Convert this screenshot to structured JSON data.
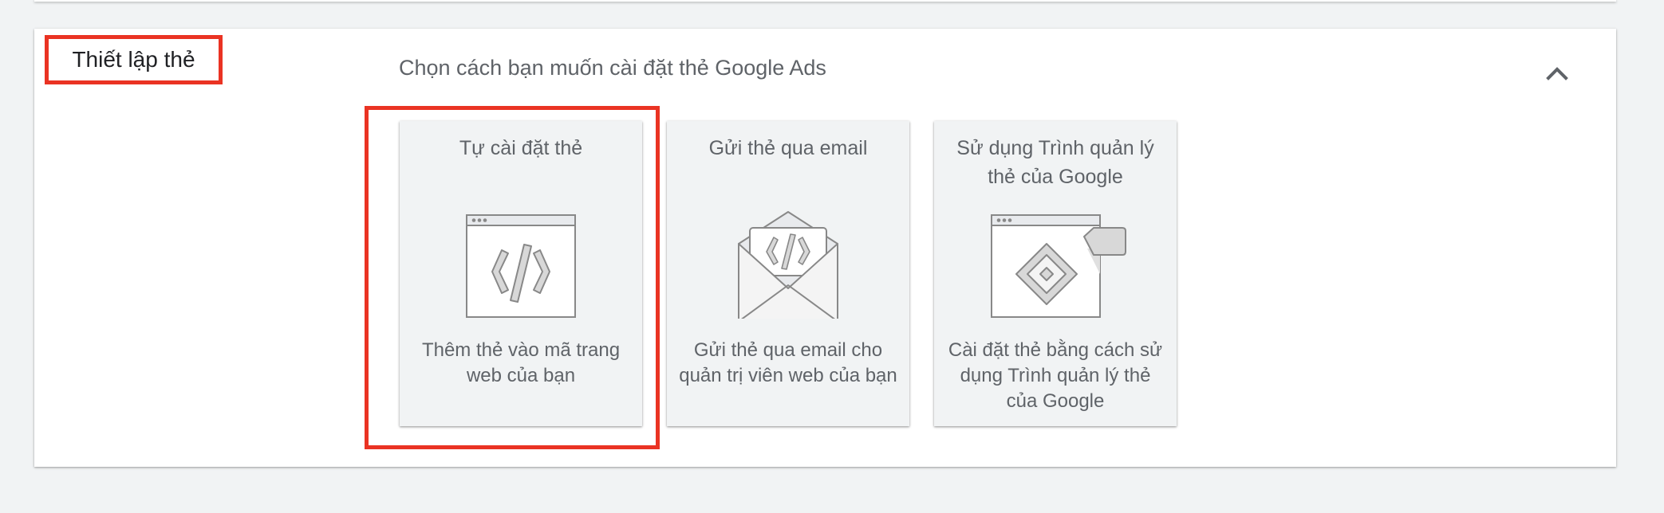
{
  "section": {
    "title": "Thiết lập thẻ",
    "prompt": "Chọn cách bạn muốn cài đặt thẻ Google Ads"
  },
  "options": [
    {
      "title": "Tự cài đặt thẻ",
      "description": "Thêm thẻ vào mã trang web của bạn",
      "icon": "browser-code-icon",
      "highlighted": true
    },
    {
      "title": "Gửi thẻ qua email",
      "description": "Gửi thẻ qua email cho quản trị viên web của bạn",
      "icon": "email-code-icon",
      "highlighted": false
    },
    {
      "title": "Sử dụng Trình quản lý thẻ của Google",
      "description": "Cài đặt thẻ bằng cách sử dụng Trình quản lý thẻ của Google",
      "icon": "tag-manager-icon",
      "highlighted": false
    }
  ],
  "icons": {
    "collapse": "chevron-up-icon"
  },
  "colors": {
    "highlight": "#ea3323",
    "card_background": "#f1f3f4",
    "text": "#5f6368",
    "heading": "#202124"
  }
}
